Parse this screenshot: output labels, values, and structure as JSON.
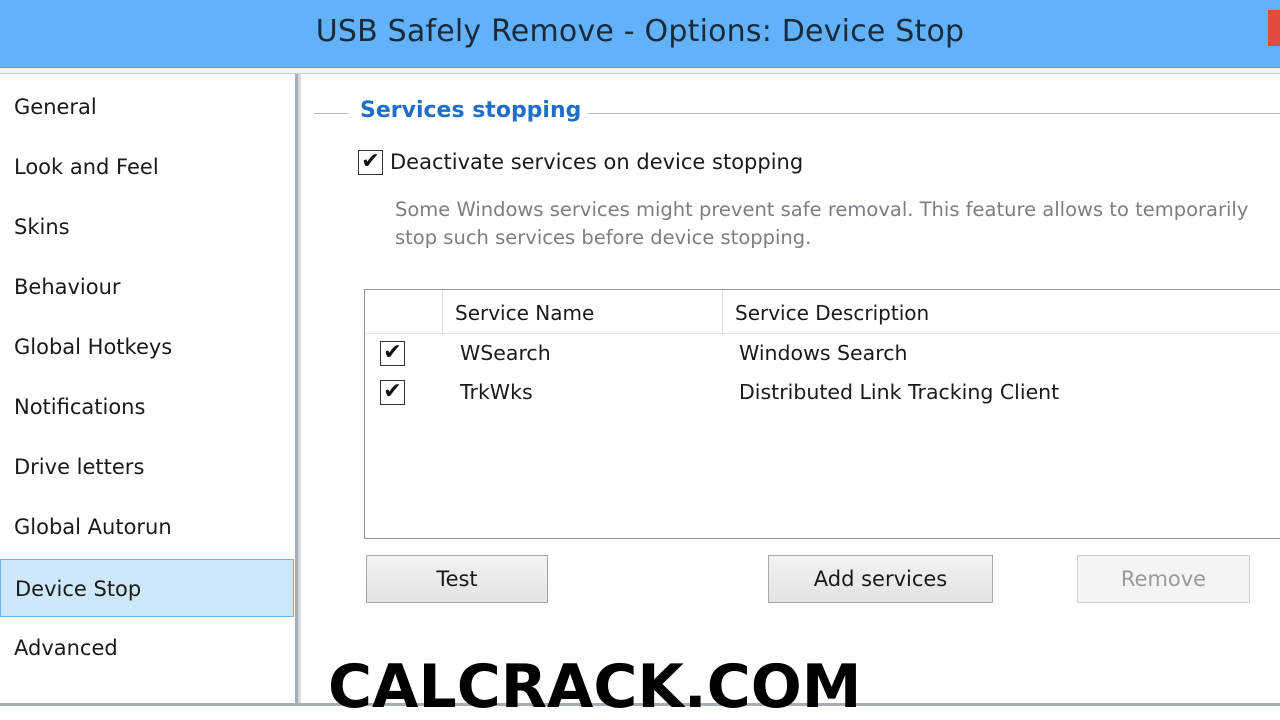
{
  "window": {
    "title": "USB Safely Remove - Options: Device Stop",
    "accent_color": "#61b1fb",
    "close_icon": "close-icon"
  },
  "sidebar": {
    "selected_color": "#cde8fb",
    "items": [
      {
        "label": "General",
        "selected": false
      },
      {
        "label": "Look and Feel",
        "selected": false
      },
      {
        "label": "Skins",
        "selected": false
      },
      {
        "label": "Behaviour",
        "selected": false
      },
      {
        "label": "Global Hotkeys",
        "selected": false
      },
      {
        "label": "Notifications",
        "selected": false
      },
      {
        "label": "Drive letters",
        "selected": false
      },
      {
        "label": "Global Autorun",
        "selected": false
      },
      {
        "label": "Device Stop",
        "selected": true
      },
      {
        "label": "Advanced",
        "selected": false
      }
    ]
  },
  "main": {
    "group_title": "Services stopping",
    "deactivate_checkbox": {
      "label": "Deactivate services on device stopping",
      "checked": true
    },
    "description": "Some Windows services might prevent safe removal. This feature allows to temporarily stop such services before device stopping.",
    "services_table": {
      "columns": [
        "Service Name",
        "Service Description"
      ],
      "rows": [
        {
          "checked": true,
          "name": "WSearch",
          "description": "Windows Search"
        },
        {
          "checked": true,
          "name": "TrkWks",
          "description": "Distributed Link Tracking Client"
        }
      ]
    },
    "buttons": {
      "test": "Test",
      "add_services": "Add services",
      "remove": "Remove"
    }
  },
  "watermark": "CALCRACK.COM",
  "check_glyph": "✔"
}
